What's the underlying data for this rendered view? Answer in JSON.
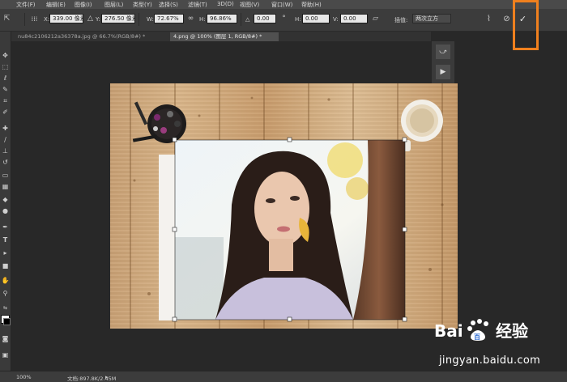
{
  "menu": [
    "文件(F)",
    "编辑(E)",
    "图像(I)",
    "图层(L)",
    "类型(Y)",
    "选择(S)",
    "滤镜(T)",
    "3D(D)",
    "视图(V)",
    "窗口(W)",
    "帮助(H)"
  ],
  "options": {
    "x_label": "X:",
    "x_value": "339.00 像素",
    "y_label": "Y:",
    "y_value": "276.50 像素",
    "w_label": "W:",
    "w_value": "72.67%",
    "h_label": "H:",
    "h_value": "96.86%",
    "angle_label": "△",
    "angle_value": "0.00",
    "hskew_label": "H:",
    "hskew_value": "0.00",
    "vskew_label": "V:",
    "vskew_value": "0.00",
    "interp_label": "插值:",
    "interp_value": "两次立方"
  },
  "tabs": [
    "nu84c2106212a36378a.jpg @ 66.7%(RGB/8#) *",
    "4.png @ 100% (图层 1, RGB/8#) *"
  ],
  "status": {
    "zoom": "100%",
    "doc_info": "文档:897.8K/2.45M"
  },
  "watermark": {
    "brand_text": "经验",
    "baidu": "Bai",
    "du": "百",
    "url": "jingyan.baidu.com"
  },
  "colors": {
    "highlight_box": "#f0801e",
    "canvas_bg": "#282828"
  },
  "icons": [
    "move-icon",
    "marquee-icon",
    "lasso-icon",
    "magic-wand-icon",
    "crop-icon",
    "eyedropper-icon",
    "healing-icon",
    "brush-icon",
    "stamp-icon",
    "history-brush-icon",
    "eraser-icon",
    "gradient-icon",
    "blur-icon",
    "dodge-icon",
    "pen-icon",
    "type-icon",
    "path-select-icon",
    "shape-icon",
    "hand-icon",
    "zoom-icon"
  ]
}
